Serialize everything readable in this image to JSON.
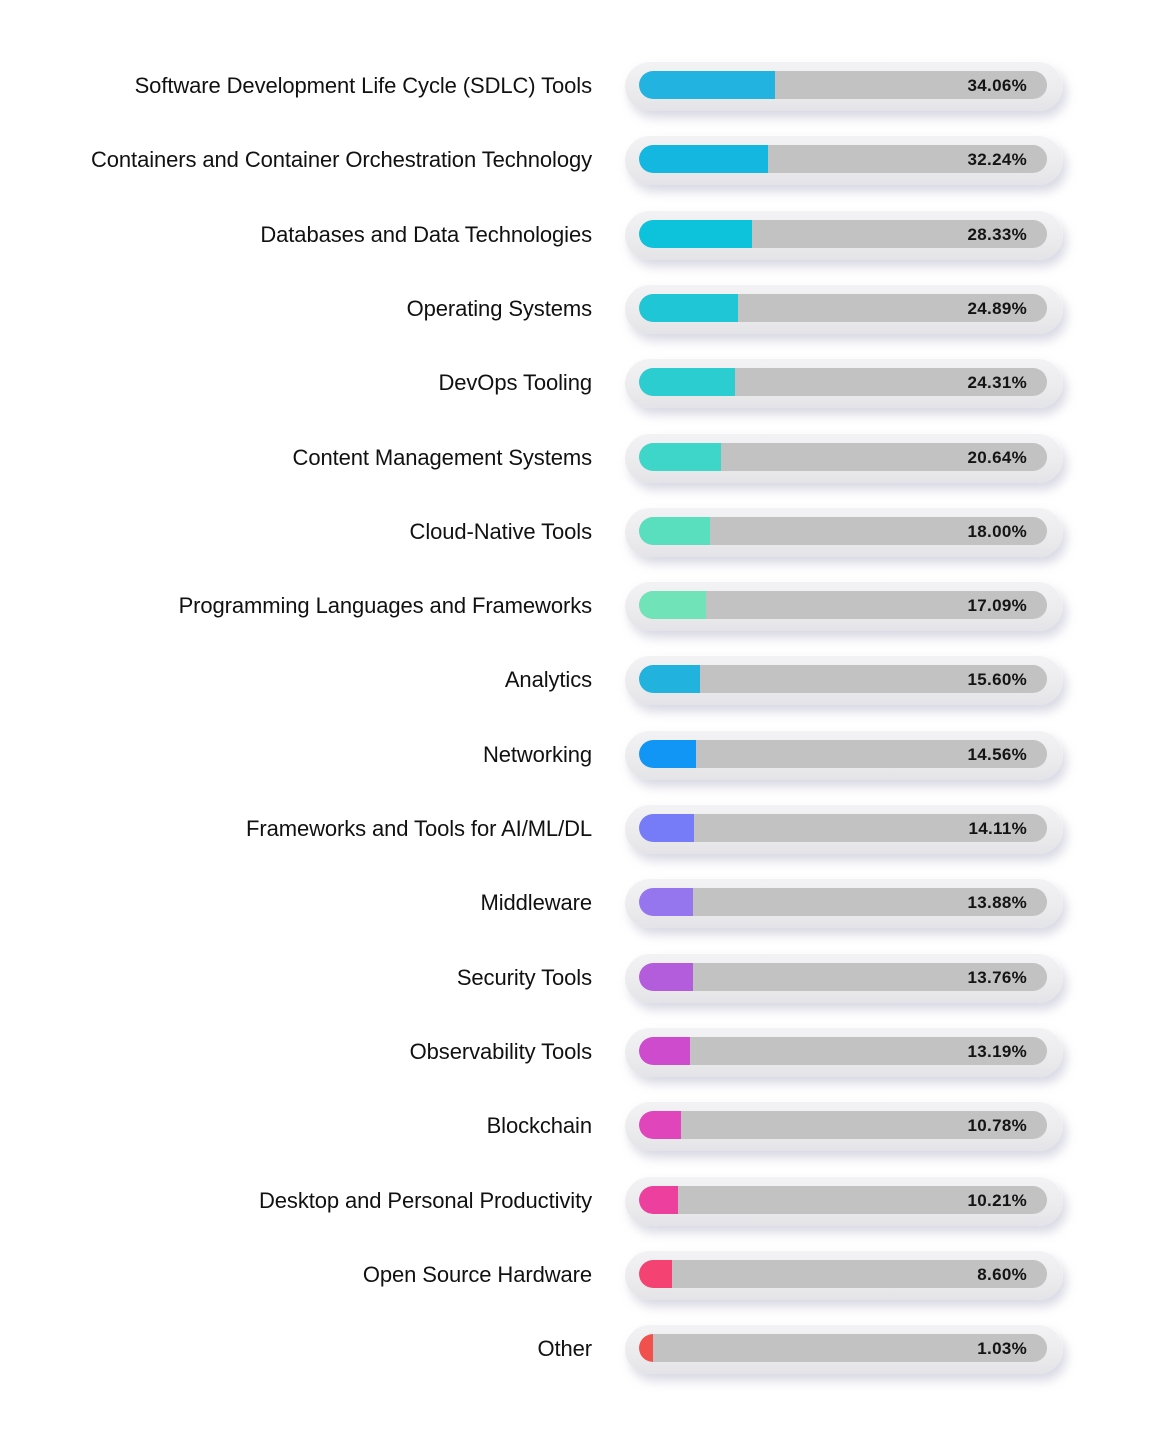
{
  "chart_data": {
    "type": "bar",
    "orientation": "horizontal",
    "title": "",
    "xlabel": "",
    "ylabel": "",
    "xlim": [
      0,
      100
    ],
    "grid": false,
    "legend": "none",
    "value_suffix": "%",
    "categories": [
      "Software Development Life Cycle (SDLC) Tools",
      "Containers and Container Orchestration Technology",
      "Databases and Data Technologies",
      "Operating Systems",
      "DevOps Tooling",
      "Content Management Systems",
      "Cloud-Native Tools",
      "Programming Languages and Frameworks",
      "Analytics",
      "Networking",
      "Frameworks and Tools for AI/ML/DL",
      "Middleware",
      "Security Tools",
      "Observability Tools",
      "Blockchain",
      "Desktop and Personal Productivity",
      "Open Source Hardware",
      "Other"
    ],
    "values": [
      34.06,
      32.24,
      28.33,
      24.89,
      24.31,
      20.64,
      18.0,
      17.09,
      15.6,
      14.56,
      14.11,
      13.88,
      13.76,
      13.19,
      10.78,
      10.21,
      8.6,
      1.03
    ],
    "value_labels": [
      "34.06%",
      "32.24%",
      "28.33%",
      "24.89%",
      "24.31%",
      "20.64%",
      "18.00%",
      "17.09%",
      "15.60%",
      "14.56%",
      "14.11%",
      "13.88%",
      "13.76%",
      "13.19%",
      "10.78%",
      "10.21%",
      "8.60%",
      "1.03%"
    ],
    "colors": [
      "#22b3e0",
      "#13b7df",
      "#0dc2db",
      "#1fc6d6",
      "#2ccdd0",
      "#3dd6c8",
      "#5adfbe",
      "#70e3b8",
      "#21b2de",
      "#1296f6",
      "#767cf8",
      "#9576ee",
      "#b45ddc",
      "#cf4bcd",
      "#e145bb",
      "#ec3f9e",
      "#f44373",
      "#f2504d"
    ],
    "track_color": "#c2c2c2"
  }
}
